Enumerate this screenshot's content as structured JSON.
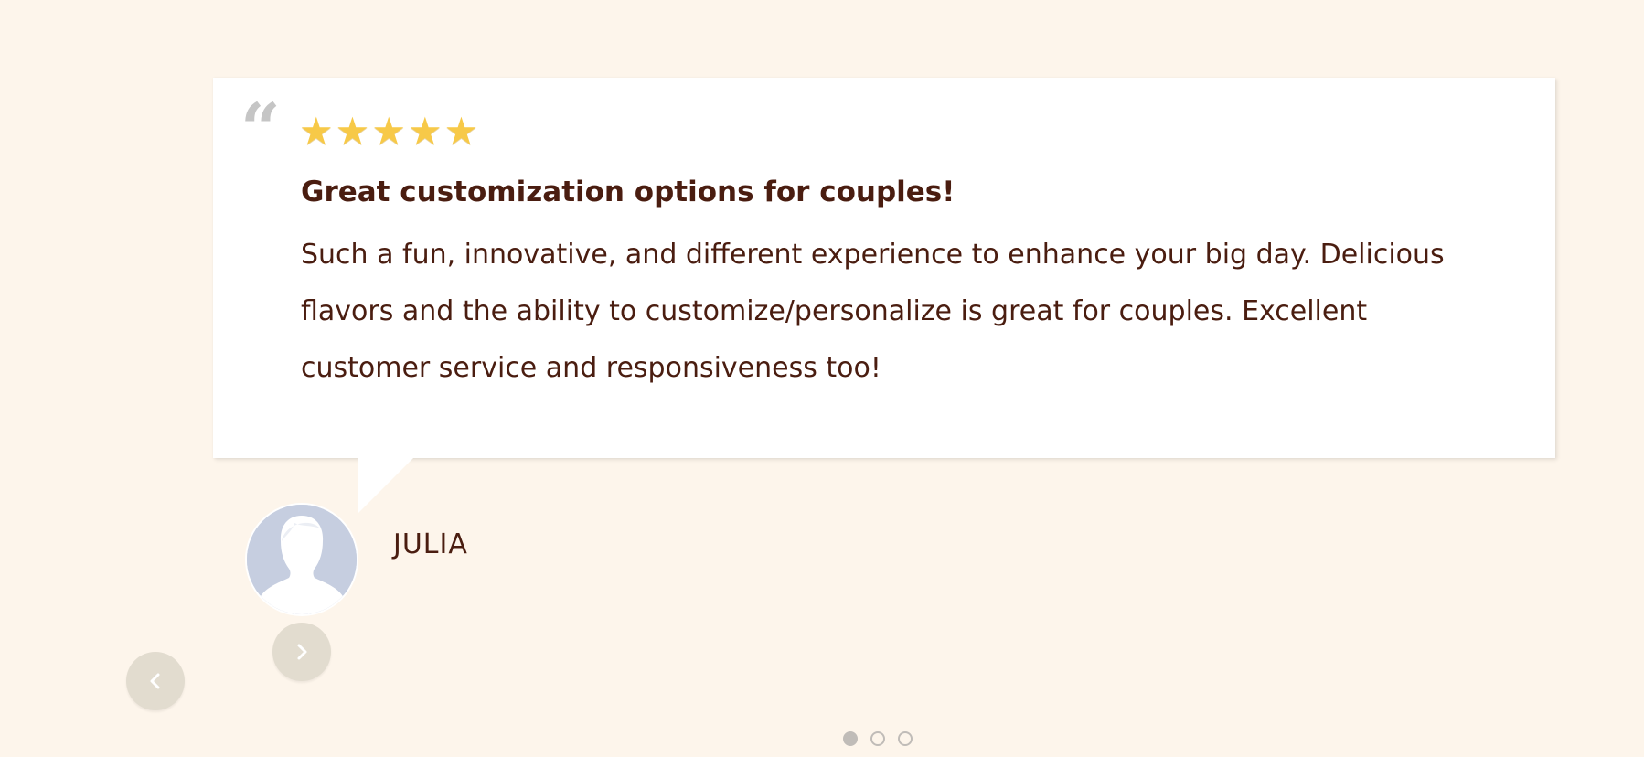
{
  "header": {
    "title_fragment": ""
  },
  "review": {
    "rating": 5,
    "stars": [
      "★",
      "★",
      "★",
      "★",
      "★"
    ],
    "quote_glyph": "“",
    "title": "Great customization options for couples!",
    "body": "Such a fun, innovative, and different experience to enhance your big day. Delicious flavors and the ability to customize/personalize is great for couples. Excellent customer service and responsiveness too!",
    "reviewer_name": "JULIA"
  },
  "carousel": {
    "slide_count": 3,
    "active_index": 0,
    "prev_icon": "chevron-left-icon",
    "next_icon": "chevron-right-icon"
  },
  "colors": {
    "background": "#fdf5eb",
    "text": "#4a1d10",
    "star": "#f7c948",
    "quote_mark": "#c5c5c5",
    "avatar_bg": "#c6cee0",
    "nav_button": "#e2dccf",
    "dot": "#c0bcb8"
  }
}
